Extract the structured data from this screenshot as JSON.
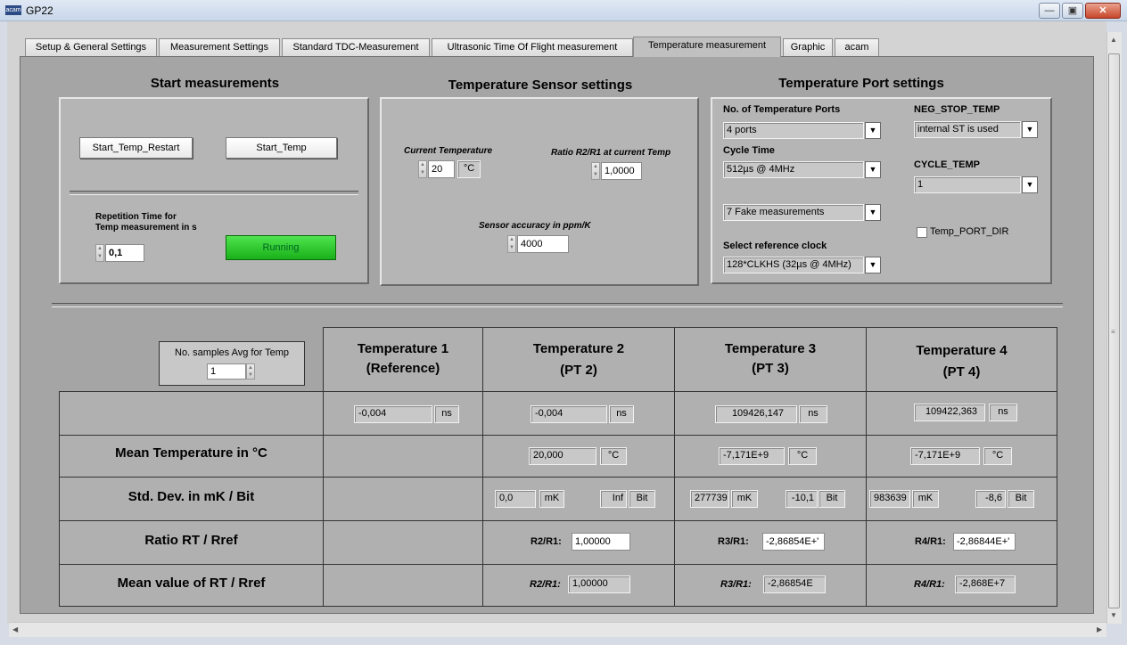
{
  "window": {
    "app_icon": "acam",
    "title": "GP22"
  },
  "tabs": [
    {
      "label": "Setup & General Settings"
    },
    {
      "label": "Measurement Settings"
    },
    {
      "label": "Standard TDC-Measurement"
    },
    {
      "label": "Ultrasonic Time Of Flight measurement"
    },
    {
      "label": "Temperature measurement"
    },
    {
      "label": "Graphic"
    },
    {
      "label": "acam"
    }
  ],
  "start": {
    "title": "Start measurements",
    "restart_btn": "Start_Temp_Restart",
    "start_btn": "Start_Temp",
    "rep_label_1": "Repetition Time for",
    "rep_label_2": "Temp measurement in s",
    "rep_value": "0,1",
    "running": "Running"
  },
  "sensor": {
    "title": "Temperature Sensor settings",
    "current_temp_label": "Current Temperature",
    "current_temp_value": "20",
    "current_temp_unit": "°C",
    "ratio_label": "Ratio R2/R1 at current Temp",
    "ratio_value": "1,0000",
    "accuracy_label": "Sensor accuracy  in ppm/K",
    "accuracy_value": "4000"
  },
  "port": {
    "title": "Temperature Port settings",
    "num_ports_label": "No. of Temperature Ports",
    "num_ports_value": "4 ports",
    "cycle_time_label": "Cycle Time",
    "cycle_time_value": "512µs @ 4MHz",
    "fake_value": "7 Fake measurements",
    "ref_clock_label": "Select reference clock",
    "ref_clock_value": "128*CLKHS (32µs @ 4MHz)",
    "neg_stop_label": "NEG_STOP_TEMP",
    "neg_stop_value": "internal ST is used",
    "cycle_temp_label": "CYCLE_TEMP",
    "cycle_temp_value": "1",
    "port_dir_label": "Temp_PORT_DIR"
  },
  "table": {
    "samples_label": "No. samples Avg for Temp",
    "samples_value": "1",
    "headers": [
      {
        "line1": "Temperature  1",
        "line2": "(Reference)"
      },
      {
        "line1": "Temperature 2",
        "line2": "(PT 2)"
      },
      {
        "line1": "Temperature 3",
        "line2": "(PT 3)"
      },
      {
        "line1": "Temperature 4",
        "line2": "(PT 4)"
      }
    ],
    "row_labels": {
      "mean_temp": "Mean Temperature in °C",
      "std_dev": "Std. Dev. in mK / Bit",
      "ratio": "Ratio RT / Rref",
      "mean_ratio": "Mean value of RT / Rref"
    },
    "time_values": [
      "-0,004",
      "-0,004",
      "109426,147",
      "109422,363"
    ],
    "time_unit": "ns",
    "mean_temp_values": [
      "20,000",
      "-7,171E+9",
      "-7,171E+9"
    ],
    "temp_unit": "°C",
    "std_mk": [
      "0,0",
      "277739",
      "983639"
    ],
    "std_bit": [
      "Inf",
      "-10,1",
      "-8,6"
    ],
    "mk_unit": "mK",
    "bit_unit": "Bit",
    "ratio_labels": [
      "R2/R1:",
      "R3/R1:",
      "R4/R1:"
    ],
    "ratio_values": [
      "1,00000",
      "-2,86854E+'",
      "-2,86844E+'"
    ],
    "mean_ratio_values": [
      "1,00000",
      "-2,86854E",
      "-2,868E+7"
    ]
  }
}
